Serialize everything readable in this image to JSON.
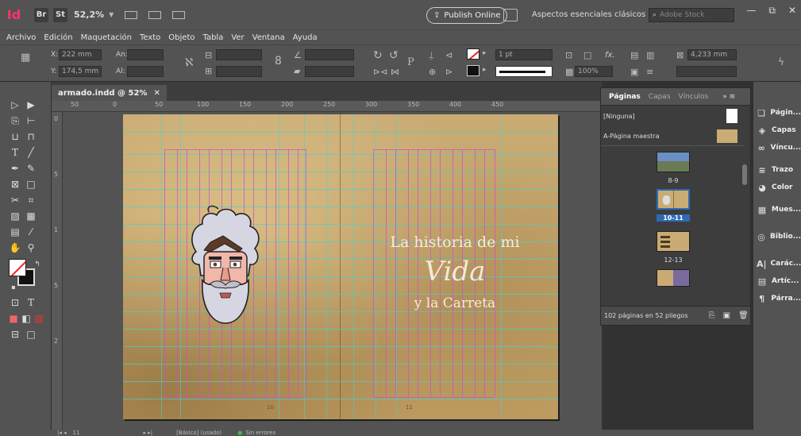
{
  "app": {
    "logo": "Id",
    "bridge": "Br",
    "stock": "St",
    "zoom": "52,2%",
    "publish_label": "Publish Online",
    "workspace": "Aspectos esenciales clásicos",
    "stock_search_placeholder": "Adobe Stock",
    "window_controls": [
      "—",
      "⧉",
      "✕"
    ]
  },
  "menu": [
    "Archivo",
    "Edición",
    "Maquetación",
    "Texto",
    "Objeto",
    "Tabla",
    "Ver",
    "Ventana",
    "Ayuda"
  ],
  "control_panel": {
    "x_label": "X:",
    "x_value": "222 mm",
    "y_label": "Y:",
    "y_value": "174,5 mm",
    "w_label": "An:",
    "w_value": "",
    "h_label": "Al:",
    "h_value": "",
    "stroke_weight": "1 pt",
    "scale": "100%",
    "fx": "fx.",
    "gutter": "4,233 mm"
  },
  "document_tab": {
    "name": "armado.indd @ 52%",
    "close": "✕"
  },
  "rulers": {
    "h_ticks": [
      "50",
      "0",
      "50",
      "100",
      "150",
      "200",
      "250",
      "300",
      "350",
      "400",
      "450"
    ],
    "v_ticks": [
      "0",
      "5",
      "1",
      "5",
      "2"
    ]
  },
  "spread": {
    "title_line1": "La historia de mi",
    "title_line2": "Vida",
    "title_line3": "y la Carreta",
    "page_left": "10",
    "page_right": "11"
  },
  "pages_panel": {
    "tabs": [
      "Páginas",
      "Capas",
      "Vínculos"
    ],
    "none_label": "[Ninguna]",
    "master_label": "A-Página maestra",
    "spread_labels": [
      "8-9",
      "10-11",
      "12-13"
    ],
    "footer": "102 páginas en 52 pliegos"
  },
  "dock": [
    "Págin...",
    "Capas",
    "Víncu...",
    "Trazo",
    "Color",
    "Mues...",
    "Biblio...",
    "Carác...",
    "Artíc...",
    "Párra..."
  ],
  "status": {
    "page": "11",
    "style": "[Básico] (usado)",
    "errors": "Sin errores"
  }
}
